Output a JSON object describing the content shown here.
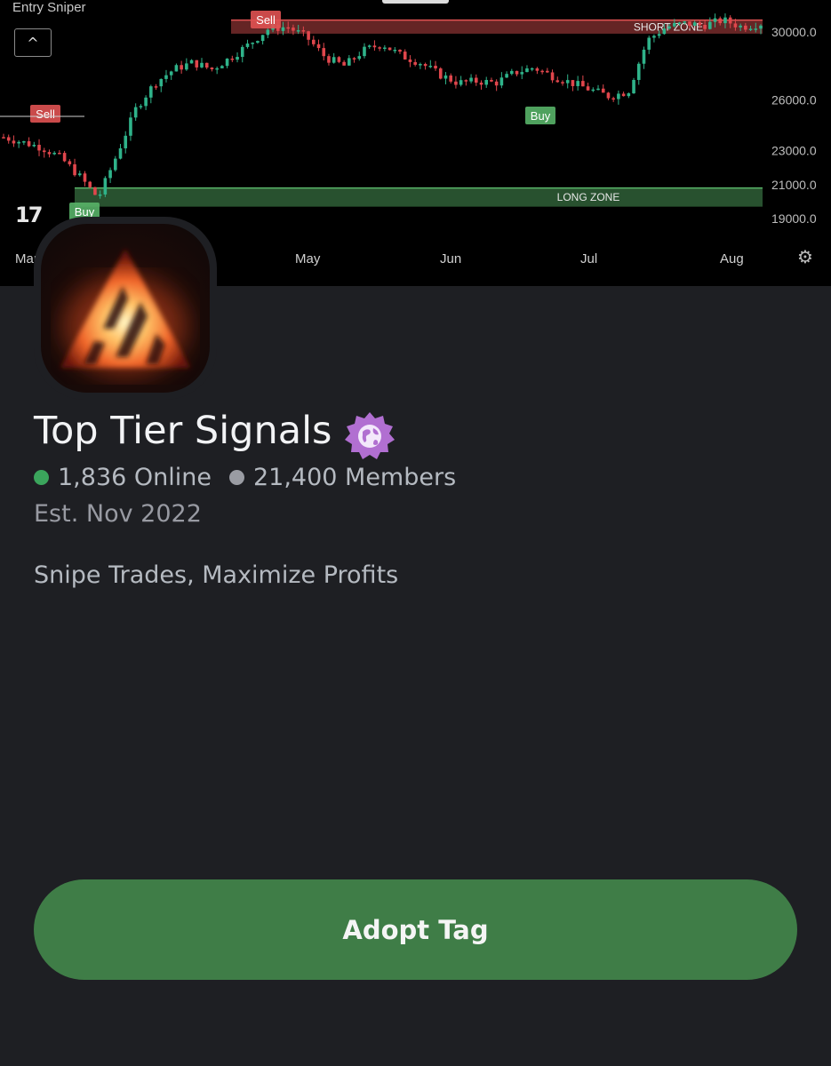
{
  "banner": {
    "title": "Entry Sniper",
    "collapse_glyph": "^",
    "logo_text": "17",
    "settings_icon": "settings-icon",
    "chart_data": {
      "type": "candlestick",
      "title": "Entry Sniper",
      "x_tick_labels": [
        "Mar",
        "May",
        "Jun",
        "Jul",
        "Aug"
      ],
      "y_tick_labels": [
        "30000.0",
        "26000.0",
        "23000.0",
        "21000.0",
        "19000.0"
      ],
      "ylim": [
        18000,
        31500
      ],
      "zones": [
        {
          "label": "SHORT ZONE",
          "y_range": [
            29900,
            30700
          ],
          "color": "#e05252"
        },
        {
          "label": "LONG ZONE",
          "y_range": [
            19700,
            20800
          ],
          "color": "#58b368"
        }
      ],
      "signals": [
        {
          "label": "Sell",
          "x": "Mar",
          "y": 24600,
          "color": "#e05252"
        },
        {
          "label": "Buy",
          "x": "Mar",
          "y": 19800,
          "color": "#58b368"
        },
        {
          "label": "Sell",
          "x": "Apr",
          "y": 30800,
          "color": "#e05252"
        },
        {
          "label": "Buy",
          "x": "Jun",
          "y": 25000,
          "color": "#58b368"
        }
      ],
      "price_path": [
        23800,
        23500,
        23200,
        22600,
        21500,
        20200,
        22800,
        25500,
        27000,
        27800,
        28200,
        27800,
        28500,
        29300,
        30200,
        30300,
        29700,
        28500,
        28000,
        28900,
        29300,
        28600,
        28200,
        27500,
        27000,
        27100,
        27000,
        27600,
        27900,
        27400,
        27000,
        26600,
        26200,
        26500,
        29500,
        30300,
        30500,
        30400,
        30700,
        30300,
        30500
      ]
    }
  },
  "server": {
    "name": "Top Tier Signals",
    "badge_icon": "globe-icon",
    "online_count": "1,836 Online",
    "member_count": "21,400 Members",
    "established": "Est. Nov 2022",
    "description": "Snipe Trades, Maximize Profits"
  },
  "actions": {
    "adopt_label": "Adopt Tag"
  },
  "colors": {
    "background": "#1e1f23",
    "button": "#3f7d47",
    "online": "#3ba55c",
    "badge": "#b16fd1"
  }
}
